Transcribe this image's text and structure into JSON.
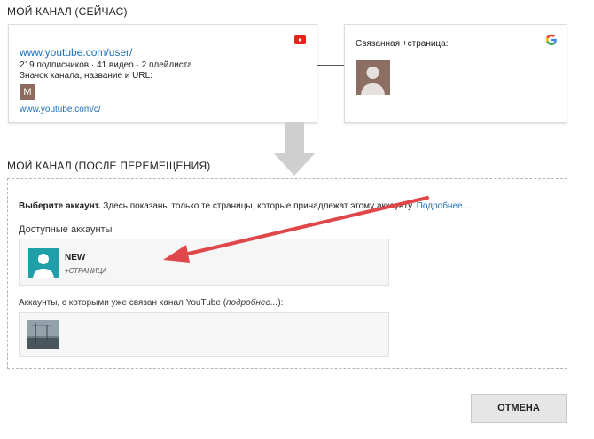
{
  "current": {
    "title": "МОЙ КАНАЛ (СЕЙЧАС)",
    "channel_url": "www.youtube.com/user/",
    "stats": "219 подписчиков · 41 видео · 2 плейлиста",
    "icon_line": "Значок канала, название и URL:",
    "avatar_letter": "M",
    "short_url": "www.youtube.com/c/",
    "linked_label": "Связанная +страница:"
  },
  "after": {
    "title": "МОЙ КАНАЛ (ПОСЛЕ ПЕРЕМЕЩЕНИЯ)",
    "choose_bold": "Выберите аккаунт.",
    "choose_rest": " Здесь показаны только те страницы, которые принадлежат этому аккаунту.",
    "more_link": "Подробнее...",
    "available_label": "Доступные аккаунты",
    "account_name": "NEW",
    "account_type": "+СТРАНИЦА",
    "linked_intro": "Аккаунты, с которыми уже связан канал YouTube (",
    "linked_more": "подробнее...",
    "linked_end": "):"
  },
  "buttons": {
    "cancel": "ОТМЕНА"
  },
  "colors": {
    "youtube_red": "#e62117",
    "link_blue": "#1f6fb8",
    "avatar_teal": "#1fa0a8",
    "arrow_red": "#e0474a"
  }
}
